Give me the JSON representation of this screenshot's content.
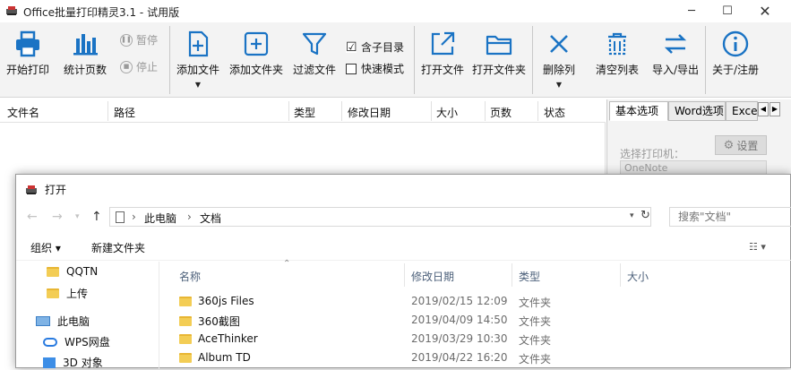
{
  "window": {
    "title": "Office批量打印精灵3.1 - 试用版"
  },
  "colors": {
    "accent": "#1a73c4",
    "toolbar_bg": "#f3f3f3",
    "folder": "#f3cd55"
  },
  "toolbar": {
    "start_print": "开始打印",
    "count_pages": "统计页数",
    "pause": "暂停",
    "stop": "停止",
    "add_file": "添加文件",
    "add_folder": "添加文件夹",
    "filter_file": "过滤文件",
    "include_subdir": "含子目录",
    "include_subdir_checked": "☑",
    "fast_mode": "快速模式",
    "open_file": "打开文件",
    "open_folder": "打开文件夹",
    "delete_col": "删除列",
    "clear_list": "清空列表",
    "import_export": "导入/导出",
    "about": "关于/注册"
  },
  "file_list": {
    "columns": [
      "文件名",
      "路径",
      "类型",
      "修改日期",
      "大小",
      "页数",
      "状态"
    ]
  },
  "options_panel": {
    "tabs": [
      "基本选项",
      "Word选项",
      "Excel"
    ],
    "printer_label": "选择打印机：",
    "settings_button": "设置",
    "printer_value": "OneNote"
  },
  "dialog": {
    "title": "打开",
    "breadcrumb": [
      "此电脑",
      "文档"
    ],
    "search_placeholder": "搜索\"文档\"",
    "organize": "组织 ▾",
    "new_folder": "新建文件夹",
    "nav_items": [
      {
        "label": "QQTN",
        "icon": "folder-icon"
      },
      {
        "label": "上传",
        "icon": "folder-icon"
      },
      {
        "label": "此电脑",
        "icon": "computer-icon"
      },
      {
        "label": "WPS网盘",
        "icon": "cloud-icon"
      },
      {
        "label": "3D 对象",
        "icon": "3d-objects-icon"
      }
    ],
    "columns": [
      "名称",
      "修改日期",
      "类型",
      "大小"
    ],
    "files": [
      {
        "name": "360js Files",
        "date": "2019/02/15 12:09",
        "type": "文件夹"
      },
      {
        "name": "360截图",
        "date": "2019/04/09 14:50",
        "type": "文件夹"
      },
      {
        "name": "AceThinker",
        "date": "2019/03/29 10:30",
        "type": "文件夹"
      },
      {
        "name": "Album TD",
        "date": "2019/04/22 16:20",
        "type": "文件夹"
      }
    ]
  }
}
